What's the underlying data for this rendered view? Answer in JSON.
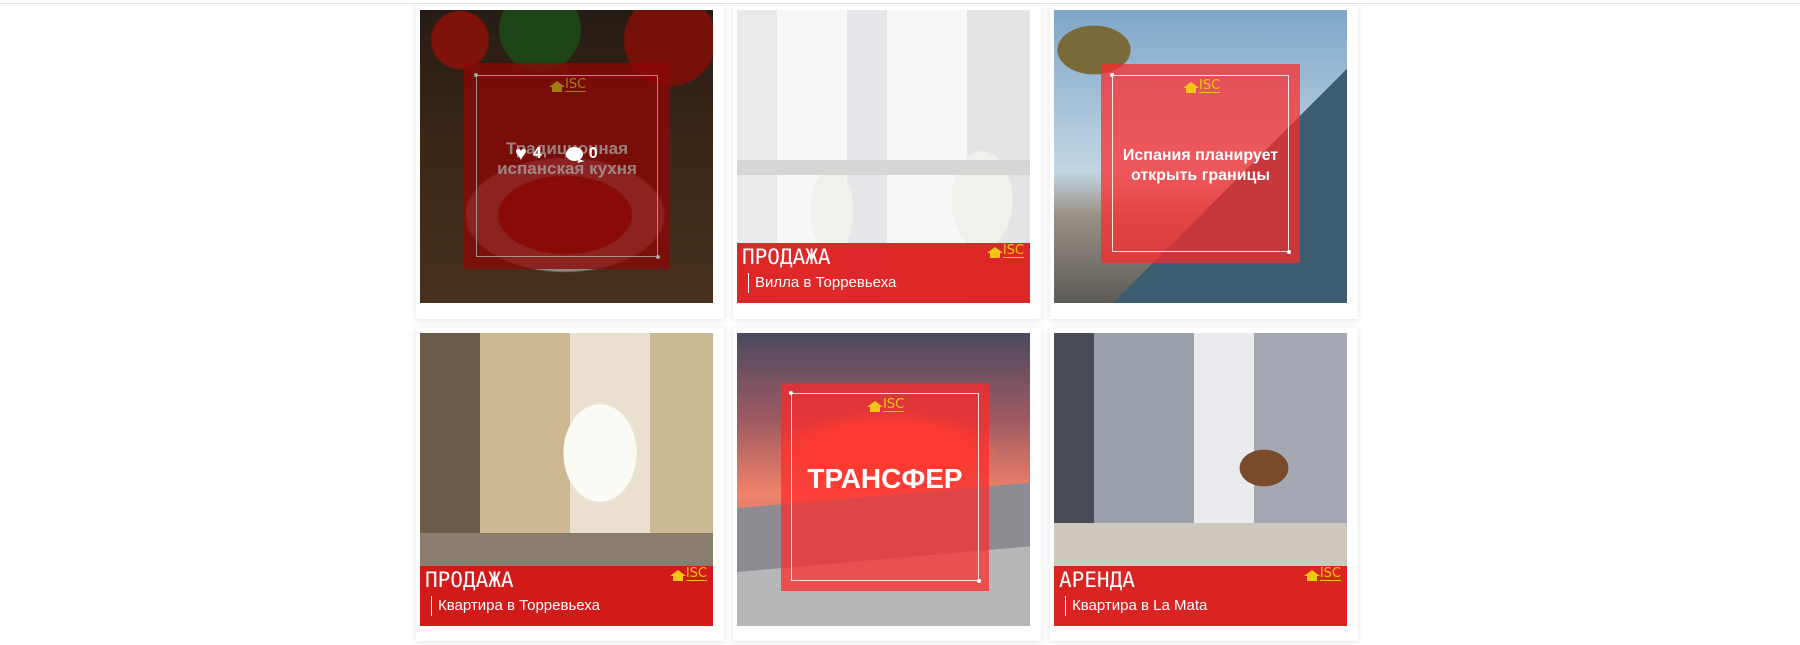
{
  "cards": [
    {
      "center_title": "Традиционная испанская кухня",
      "likes": "4",
      "comments": "0",
      "logo_text": "ISC",
      "colors": {
        "overlay": "#d60a0a",
        "logo": "#f4c517"
      },
      "icons": [
        "heart-icon",
        "comment-icon"
      ]
    },
    {
      "banner_type": "ПРОДАЖА",
      "banner_subtitle": "Вилла в Торревьеха",
      "logo_text": "ISC"
    },
    {
      "center_title": "Испания планирует открыть границы",
      "logo_text": "ISC"
    },
    {
      "banner_type": "ПРОДАЖА",
      "banner_subtitle": "Квартира в Торревьеха",
      "logo_text": "ISC"
    },
    {
      "center_title": "ТРАНСФЕР",
      "logo_text": "ISC"
    },
    {
      "banner_type": "АРЕНДА",
      "banner_subtitle": "Квартира в La Mata",
      "logo_text": "ISC"
    }
  ]
}
